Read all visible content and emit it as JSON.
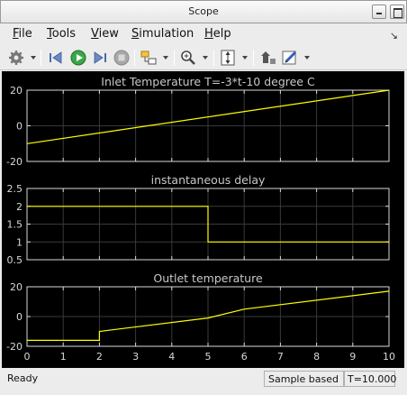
{
  "window": {
    "title": "Scope"
  },
  "menu": [
    {
      "label": "File",
      "mnemonic": "F",
      "rest": "ile"
    },
    {
      "label": "Tools",
      "mnemonic": "T",
      "rest": "ools"
    },
    {
      "label": "View",
      "mnemonic": "V",
      "rest": "iew"
    },
    {
      "label": "Simulation",
      "mnemonic": "S",
      "rest": "imulation"
    },
    {
      "label": "Help",
      "mnemonic": "H",
      "rest": "elp"
    }
  ],
  "toolbar": {
    "icons": [
      "gear-icon",
      "step-back-icon",
      "run-icon",
      "step-forward-icon",
      "stop-icon",
      "highlight-block-icon",
      "zoom-icon",
      "scale-axes-icon",
      "restore-layout-icon",
      "style-icon"
    ]
  },
  "status": {
    "ready": "Ready",
    "mode": "Sample based",
    "time": "T=10.000"
  },
  "colors": {
    "plot_bg": "#000000",
    "axes_bg": "#000000",
    "axis_fg": "#d8d8d8",
    "grid": "#3a3a3a",
    "trace": "#ffff00"
  },
  "chart_data": [
    {
      "type": "line",
      "title": "Inlet Temperature T=-3*t-10 degree C",
      "xlim": [
        0,
        10
      ],
      "ylim": [
        -20,
        20
      ],
      "xticks": [
        0,
        1,
        2,
        3,
        4,
        5,
        6,
        7,
        8,
        9,
        10
      ],
      "yticks": [
        -20,
        0,
        20
      ],
      "grid": true,
      "series": [
        {
          "x": [
            0,
            10
          ],
          "y": [
            -10,
            20
          ]
        }
      ]
    },
    {
      "type": "line",
      "title": "instantaneous delay",
      "xlim": [
        0,
        10
      ],
      "ylim": [
        0.5,
        2.5
      ],
      "xticks": [
        0,
        1,
        2,
        3,
        4,
        5,
        6,
        7,
        8,
        9,
        10
      ],
      "yticks": [
        0.5,
        1,
        1.5,
        2,
        2.5
      ],
      "grid": true,
      "series": [
        {
          "x": [
            0,
            5,
            5,
            10
          ],
          "y": [
            2,
            2,
            1,
            1
          ]
        }
      ]
    },
    {
      "type": "line",
      "title": "Outlet temperature",
      "xlim": [
        0,
        10
      ],
      "ylim": [
        -20,
        20
      ],
      "xticks": [
        0,
        1,
        2,
        3,
        4,
        5,
        6,
        7,
        8,
        9,
        10
      ],
      "yticks": [
        -20,
        0,
        20
      ],
      "xticklabels": [
        "0",
        "1",
        "2",
        "3",
        "4",
        "5",
        "6",
        "7",
        "8",
        "9",
        "10"
      ],
      "grid": true,
      "series": [
        {
          "x": [
            0,
            2,
            2,
            5,
            6,
            10
          ],
          "y": [
            -16,
            -16,
            -10,
            -1,
            5,
            17
          ]
        }
      ]
    }
  ]
}
